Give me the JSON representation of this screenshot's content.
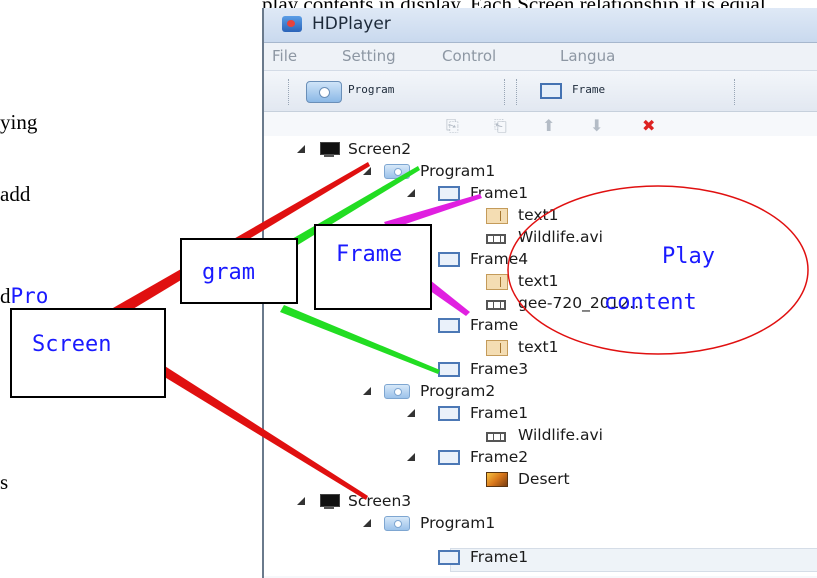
{
  "document": {
    "header_fragment": "play contents in display. Each Screen relationship it is equal.",
    "left_fragments": [
      "ying",
      "add",
      "d",
      "s"
    ],
    "left_fragment_blue": "Pro"
  },
  "window": {
    "title": "HDPlayer",
    "menu": [
      "File",
      "Setting",
      "Control",
      "Langua"
    ],
    "toolbar": {
      "program_label": "Program",
      "frame_label": "Frame"
    }
  },
  "tree": {
    "screen2": "Screen2",
    "s2_program1": "Program1",
    "s2_p1_frame1": "Frame1",
    "s2_p1_f1_text1": "text1",
    "s2_p1_f1_video": "Wildlife.avi",
    "s2_p1_frame4": "Frame4",
    "s2_p1_f4_text1": "text1",
    "s2_p1_f4_video": "gee-720_2012...",
    "s2_p1_frame_hidden": "Frame",
    "s2_p1_fh_text1": "text1",
    "s2_p1_frame3": "Frame3",
    "s2_program2": "Program2",
    "s2_p2_frame1": "Frame1",
    "s2_p2_f1_video": "Wildlife.avi",
    "s2_p2_frame2": "Frame2",
    "s2_p2_f2_image": "Desert",
    "screen3": "Screen3",
    "s3_program1": "Program1",
    "s3_p1_frame1": "Frame1"
  },
  "annotations": {
    "screen_box": "Screen",
    "program_box": "gram",
    "frame_box": "Frame",
    "play_line1": "Play",
    "play_line2": "content",
    "colors": {
      "screen_lines": "#e01010",
      "program_lines": "#22dd22",
      "frame_lines": "#e020e0",
      "circle": "#e01010",
      "label_text": "#1a1aff"
    }
  }
}
